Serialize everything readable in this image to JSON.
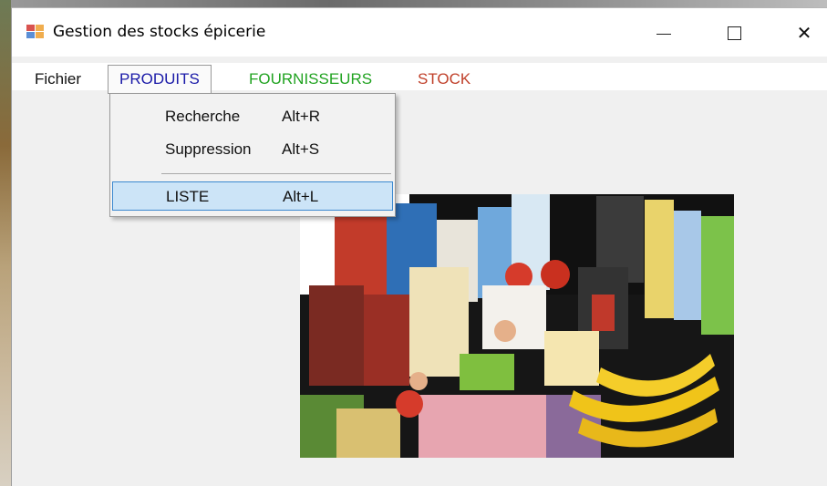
{
  "window": {
    "title": "Gestion des stocks épicerie",
    "minimize_glyph": "—",
    "close_glyph": "✕"
  },
  "menubar": {
    "items": [
      {
        "label": "Fichier",
        "color": "#111111"
      },
      {
        "label": "PRODUITS",
        "color": "#1a1aa8"
      },
      {
        "label": "FOURNISSEURS",
        "color": "#21a321"
      },
      {
        "label": "STOCK",
        "color": "#c0402a"
      }
    ]
  },
  "dropdown": {
    "items": [
      {
        "label": "Recherche",
        "shortcut": "Alt+R"
      },
      {
        "label": "Suppression",
        "shortcut": "Alt+S"
      },
      {
        "label": "LISTE",
        "shortcut": "Alt+L",
        "highlighted": true
      }
    ],
    "highlight_color": "#cce4f7",
    "highlight_border": "#3c89d0"
  },
  "content": {
    "image_icon": "groceries-photo"
  }
}
